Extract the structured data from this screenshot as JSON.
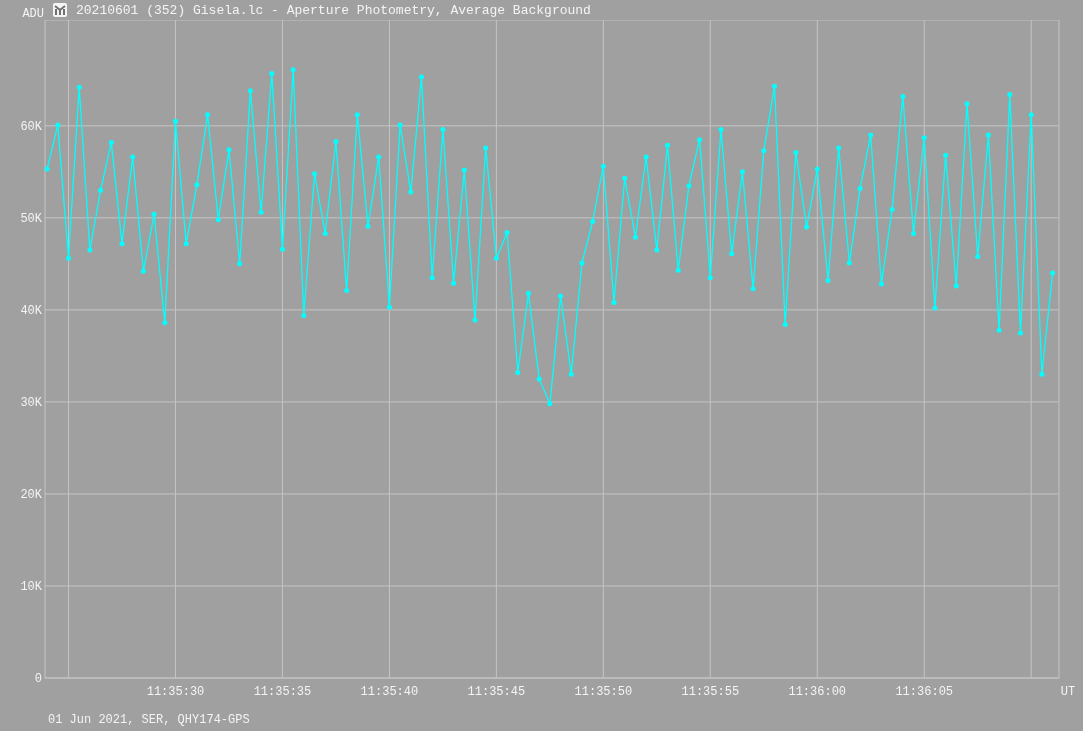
{
  "window": {
    "title": "20210601 (352) Gisela.lc - Aperture Photometry, Average Background"
  },
  "chart": {
    "chart_data": {
      "type": "line",
      "ylabel": "ADU",
      "xlabel": "UT",
      "categories": [
        null,
        null,
        null,
        null,
        null,
        null,
        null,
        null,
        null,
        null,
        null,
        null,
        "11:35:30",
        null,
        null,
        null,
        null,
        null,
        null,
        null,
        null,
        null,
        "11:35:35",
        null,
        null,
        null,
        null,
        null,
        null,
        null,
        null,
        null,
        "11:35:40",
        null,
        null,
        null,
        null,
        null,
        null,
        null,
        null,
        null,
        "11:35:45",
        null,
        null,
        null,
        null,
        null,
        null,
        null,
        null,
        null,
        "11:35:50",
        null,
        null,
        null,
        null,
        null,
        null,
        null,
        null,
        null,
        "11:35:55",
        null,
        null,
        null,
        null,
        null,
        null,
        null,
        null,
        null,
        "11:36:00",
        null,
        null,
        null,
        null,
        null,
        null,
        null,
        null,
        null,
        "11:36:05",
        null,
        null,
        null,
        null,
        null,
        null,
        null,
        null,
        null,
        null,
        null,
        null
      ],
      "series": [
        {
          "color": "#00ffff",
          "values": [
            55300,
            60100,
            45600,
            64200,
            46500,
            53000,
            58200,
            47200,
            56600,
            44200,
            50400,
            38600,
            60500,
            47200,
            53600,
            61200,
            49800,
            57400,
            45000,
            63800,
            50600,
            65700,
            46600,
            66100,
            39400,
            54800,
            48300,
            58300,
            42100,
            61200,
            49100,
            56600,
            40300,
            60100,
            52800,
            65300,
            43500,
            59600,
            42900,
            55200,
            38900,
            57600,
            45600,
            48400,
            33200,
            41800,
            32500,
            29800,
            41500,
            33000,
            45100,
            49600,
            55600,
            40800,
            54300,
            47900,
            56600,
            46500,
            57900,
            44300,
            53500,
            58500,
            43500,
            59600,
            46100,
            55000,
            42300,
            57300,
            64300,
            38400,
            57100,
            49000,
            55300,
            43200,
            57600,
            45100,
            53200,
            59000,
            42800,
            50900,
            63200,
            48300,
            58700,
            40200,
            56800,
            42600,
            62400,
            45800,
            59000,
            37800,
            63400,
            37500,
            61200,
            33000,
            44000
          ]
        }
      ],
      "grid": true,
      "ylim": [
        0,
        71500
      ],
      "yticks": [
        {
          "value": 0,
          "label": "0"
        },
        {
          "value": 10000,
          "label": "10K"
        },
        {
          "value": 20000,
          "label": "20K"
        },
        {
          "value": 30000,
          "label": "30K"
        },
        {
          "value": 40000,
          "label": "40K"
        },
        {
          "value": 50000,
          "label": "50K"
        },
        {
          "value": 60000,
          "label": "60K"
        }
      ]
    }
  },
  "footer": "01 Jun 2021, SER, QHY174-GPS"
}
